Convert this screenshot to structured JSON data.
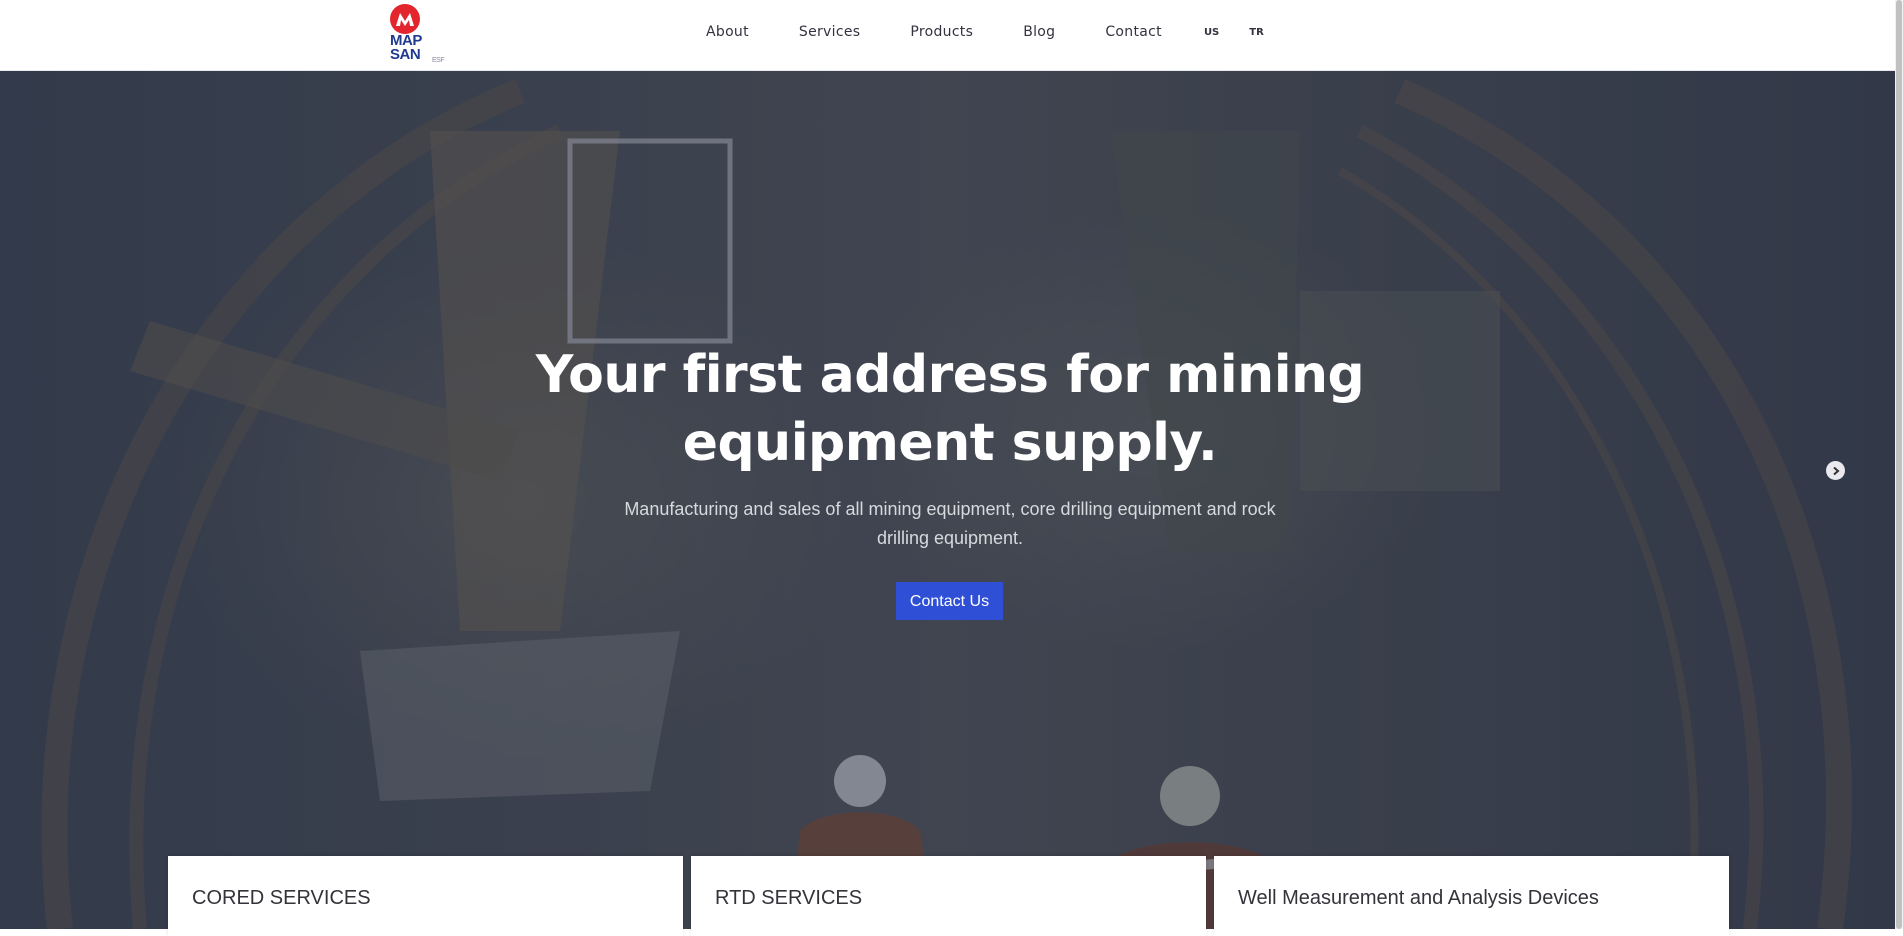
{
  "brand": {
    "logo_text_line1": "MAP",
    "logo_text_line2": "SAN",
    "logo_small": "ESF"
  },
  "nav": {
    "items": [
      "About",
      "Services",
      "Products",
      "Blog",
      "Contact"
    ],
    "languages": [
      "US",
      "TR"
    ]
  },
  "hero": {
    "title": "Your first address for mining equipment supply.",
    "subtitle": "Manufacturing and sales of all mining equipment, core drilling equipment and rock drilling equipment.",
    "cta_label": "Contact Us"
  },
  "cards": [
    {
      "title": "CORED SERVICES"
    },
    {
      "title": "RTD SERVICES"
    },
    {
      "title": "Well Measurement and Analysis Devices"
    }
  ],
  "icons": {
    "next": "chevron-right-circle-icon",
    "logo": "mapsan-logo-icon"
  },
  "colors": {
    "accent": "#2e4fd6",
    "brand_red": "#e3262e",
    "brand_blue": "#1f3a8f",
    "overlay": "#283044"
  }
}
